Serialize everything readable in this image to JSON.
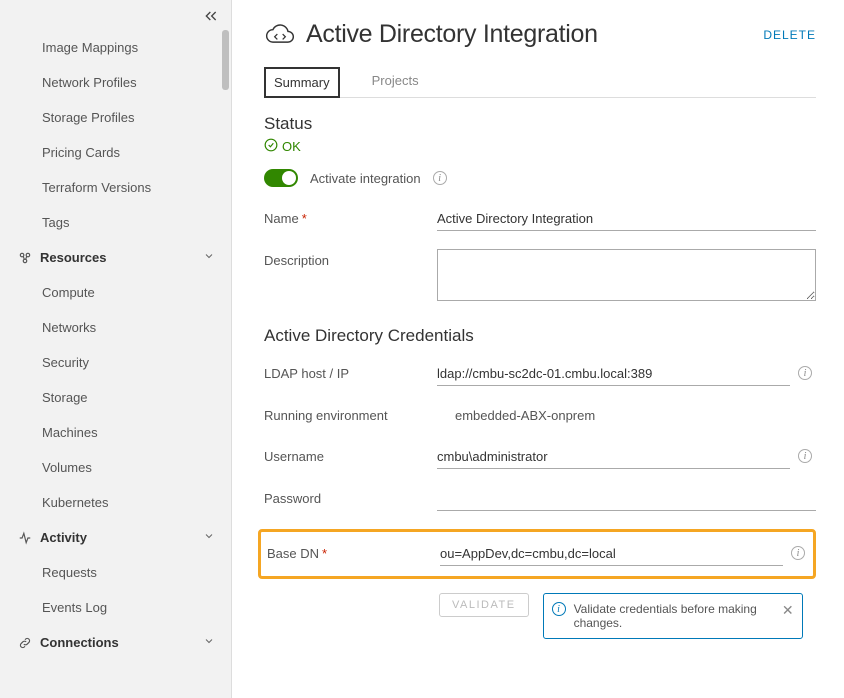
{
  "sidebar": {
    "items_top": [
      "Image Mappings",
      "Network Profiles",
      "Storage Profiles",
      "Pricing Cards",
      "Terraform Versions",
      "Tags"
    ],
    "resources_label": "Resources",
    "resources_items": [
      "Compute",
      "Networks",
      "Security",
      "Storage",
      "Machines",
      "Volumes",
      "Kubernetes"
    ],
    "activity_label": "Activity",
    "activity_items": [
      "Requests",
      "Events Log"
    ],
    "connections_label": "Connections"
  },
  "page": {
    "title": "Active Directory Integration",
    "delete_label": "DELETE",
    "tabs": {
      "summary": "Summary",
      "projects": "Projects"
    },
    "status_label": "Status",
    "status_value": "OK",
    "activate_label": "Activate integration",
    "name_label": "Name",
    "name_value": "Active Directory Integration",
    "desc_label": "Description",
    "desc_value": "",
    "cred_section": "Active Directory Credentials",
    "ldap_label": "LDAP host / IP",
    "ldap_value": "ldap://cmbu-sc2dc-01.cmbu.local:389",
    "runenv_label": "Running environment",
    "runenv_value": "embedded-ABX-onprem",
    "user_label": "Username",
    "user_value": "cmbu\\administrator",
    "pass_label": "Password",
    "pass_value": "",
    "basedn_label": "Base DN",
    "basedn_value": "ou=AppDev,dc=cmbu,dc=local",
    "validate_btn": "VALIDATE",
    "notice": "Validate credentials before making changes."
  }
}
